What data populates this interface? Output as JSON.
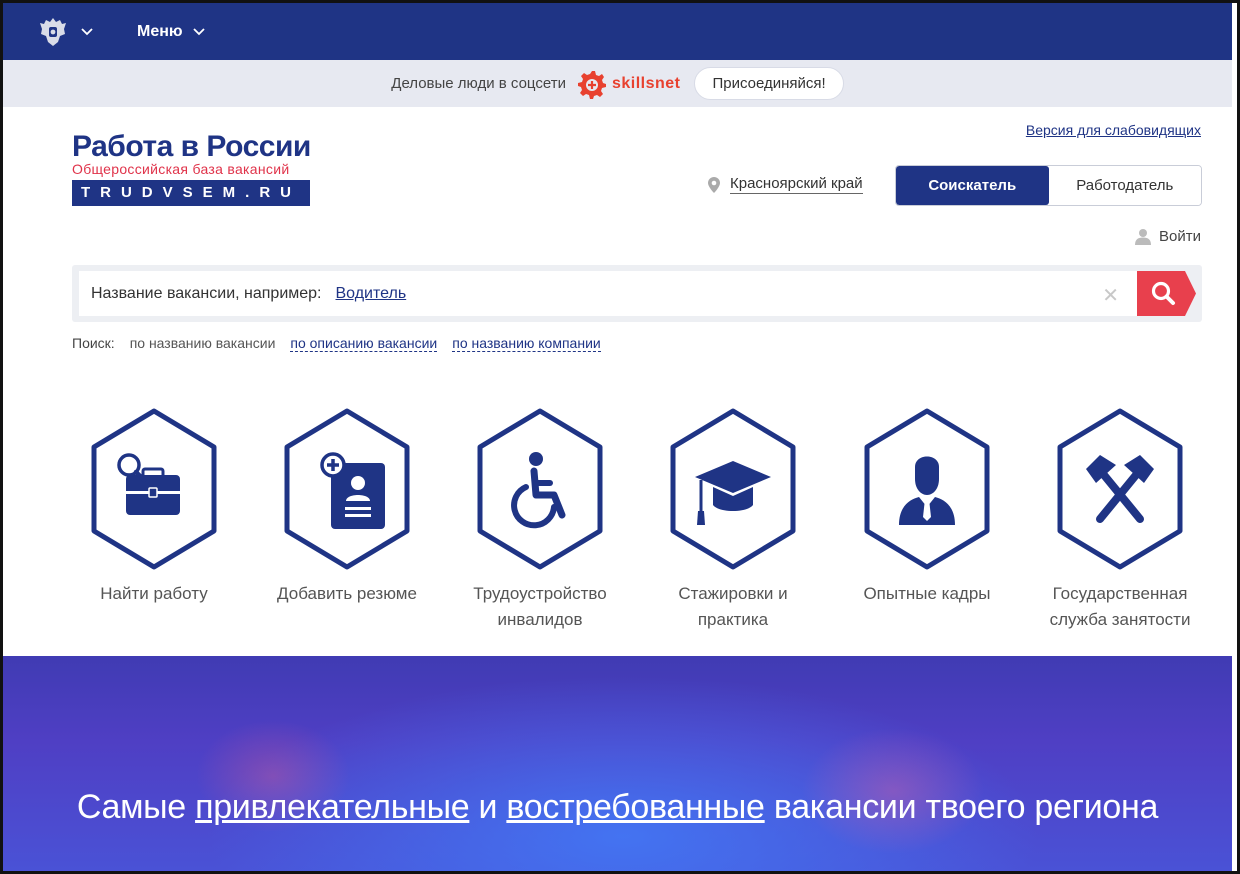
{
  "topnav": {
    "menu_label": "Меню"
  },
  "promo": {
    "text": "Деловые люди в соцсети",
    "brand": "skillsnet",
    "join_label": "Присоединяйся!"
  },
  "logo": {
    "title": "Работа в России",
    "subtitle": "Общероссийская база вакансий",
    "site": "TRUDVSEM.RU"
  },
  "header": {
    "low_vision": "Версия для слабовидящих",
    "region": "Красноярский край",
    "role_seeker": "Соискатель",
    "role_employer": "Работодатель",
    "login": "Войти"
  },
  "search": {
    "placeholder": "Название вакансии, например:",
    "example": "Водитель",
    "modes_label": "Поиск:",
    "modes": [
      "по названию вакансии",
      "по описанию вакансии",
      "по названию компании"
    ]
  },
  "tiles": [
    {
      "label": "Найти работу",
      "icon": "briefcase-search-icon"
    },
    {
      "label": "Добавить резюме",
      "icon": "add-resume-icon"
    },
    {
      "label": "Трудоустройство инвалидов",
      "icon": "wheelchair-icon"
    },
    {
      "label": "Стажировки и практика",
      "icon": "graduation-cap-icon"
    },
    {
      "label": "Опытные кадры",
      "icon": "businessman-icon"
    },
    {
      "label": "Государственная служба занятости",
      "icon": "hammers-icon"
    }
  ],
  "banner": {
    "part1": "Самые",
    "link1": "привлекательные",
    "part2": "и",
    "link2": "востребованные",
    "part3": "вакансии твоего региона"
  },
  "colors": {
    "brand_blue": "#1f3485",
    "accent_red": "#e8404d",
    "promo_bg": "#e7e9f1"
  }
}
